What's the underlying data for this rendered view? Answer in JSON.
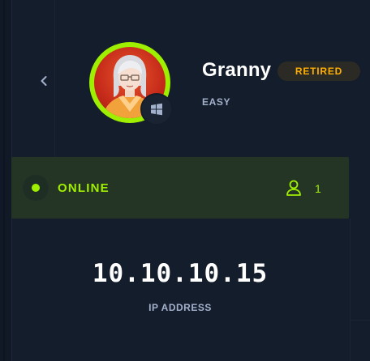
{
  "machine": {
    "name": "Granny",
    "status_badge": "RETIRED",
    "difficulty": "EASY",
    "os_icon": "windows-icon",
    "avatar": "granny-avatar"
  },
  "status": {
    "label": "ONLINE",
    "users_count": "1",
    "users_icon": "user-icon"
  },
  "network": {
    "ip": "10.10.10.15",
    "ip_label": "IP ADDRESS"
  },
  "colors": {
    "accent_green": "#9fef00",
    "retired_orange": "#ffaf00",
    "background": "#141d2b",
    "status_bg": "#253525",
    "muted_text": "#a4b1cd"
  }
}
